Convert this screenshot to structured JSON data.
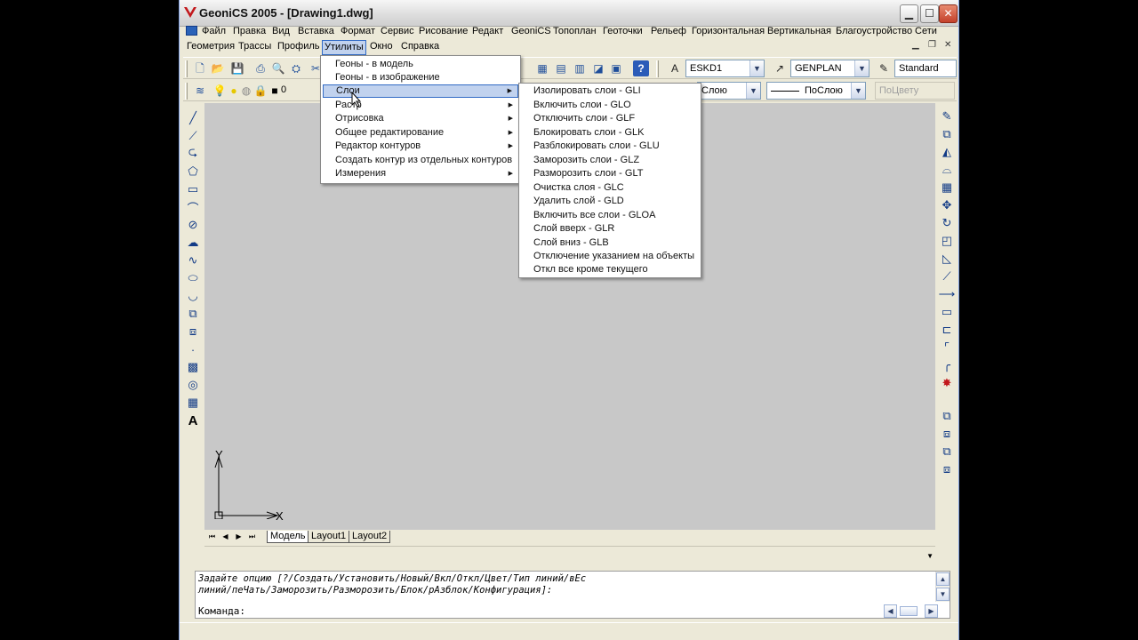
{
  "window": {
    "title": "GeoniCS 2005 - [Drawing1.dwg]",
    "minimize": "▁",
    "maximize": "☐",
    "close": "✕"
  },
  "menubar": {
    "row1": [
      "Файл",
      "Правка",
      "Вид",
      "Вставка",
      "Формат",
      "Сервис",
      "Рисование",
      "Редакт",
      "GeoniCS",
      "Топоплан",
      "Геоточки",
      "Рельеф",
      "Горизонтальная",
      "Вертикальная",
      "Благоустройство",
      "Сети"
    ],
    "row2": [
      "Геометрия",
      "Трассы",
      "Профиль",
      "Утилиты",
      "Окно",
      "Справка"
    ],
    "active": "Утилиты"
  },
  "toolbar": {
    "text_style": "ESKD1",
    "dim_style": "GENPLAN",
    "table_style": "Standard",
    "layer_name": "0",
    "color": "Слою",
    "linetype": "ПоСлою",
    "plotstyle": "ПоЦвету"
  },
  "utilities_menu": {
    "items": [
      {
        "label": "Геоны - в модель",
        "submenu": false
      },
      {
        "label": "Геоны - в изображение",
        "submenu": false
      },
      {
        "label": "Слои",
        "submenu": true,
        "highlighted": true
      },
      {
        "label": "Растр",
        "submenu": true
      },
      {
        "label": "Отрисовка",
        "submenu": true
      },
      {
        "label": "Общее редактирование",
        "submenu": true
      },
      {
        "label": "Редактор контуров",
        "submenu": true
      },
      {
        "label": "Создать контур из отдельных контуров",
        "submenu": false
      },
      {
        "label": "Измерения",
        "submenu": true
      }
    ],
    "arrow": "▶"
  },
  "layers_submenu": {
    "items": [
      "Изолировать слои - GLI",
      "Включить слои - GLO",
      "Отключить слои - GLF",
      "Блокировать слои - GLK",
      "Разблокировать слои - GLU",
      "Заморозить слои - GLZ",
      "Разморозить слои - GLT",
      "Очистка слоя - GLC",
      "Удалить слой - GLD",
      "Включить все слои - GLOA",
      "Слой вверх - GLR",
      "Слой вниз - GLB",
      "Отключение указанием на объекты",
      "Откл все кроме текущего"
    ]
  },
  "canvas": {
    "ucs_x": "X",
    "ucs_y": "Y"
  },
  "layout_tabs": {
    "tabs": [
      "Модель",
      "Layout1",
      "Layout2"
    ],
    "selected": "Модель",
    "nav": [
      "⏮",
      "◀",
      "▶",
      "⏭"
    ]
  },
  "command": {
    "line1": "Задайте опцию [?/Создать/Установить/Новый/Вкл/Откл/Цвет/Тип линий/вЕс",
    "line2": "линий/пеЧать/Заморозить/Разморозить/Блок/рАзблок/Конфигурация]:",
    "prompt": "Команда:"
  },
  "colors": {
    "canvas_bg": "#c8c8c8",
    "menu_highlight": "#c1d2ee",
    "highlight_border": "#316ac5",
    "chrome": "#ece9d8"
  }
}
